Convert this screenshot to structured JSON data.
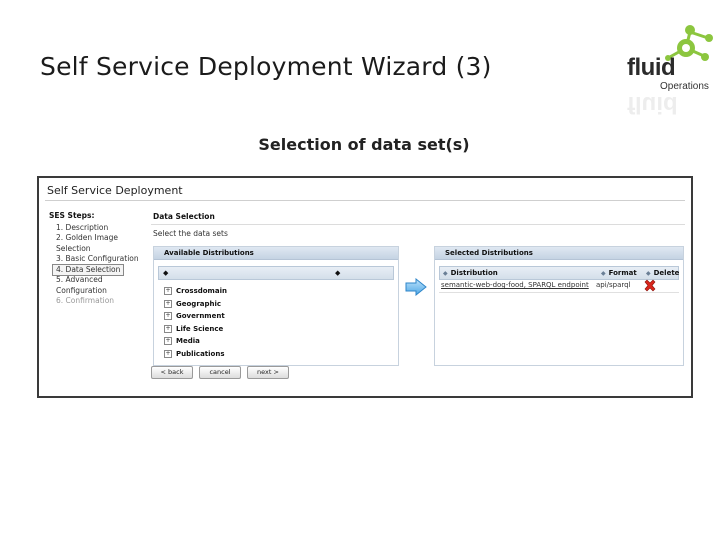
{
  "slide": {
    "title": "Self Service Deployment Wizard (3)",
    "subtitle": "Selection of data set(s)"
  },
  "logo": {
    "brand": "fluid",
    "sub": "Operations",
    "accent_color": "#8cc63f"
  },
  "app": {
    "title": "Self Service Deployment",
    "steps_header": "SES Steps:",
    "steps": [
      {
        "label": "1. Description",
        "state": "done"
      },
      {
        "label": "2. Golden Image Selection",
        "state": "done"
      },
      {
        "label": "3. Basic Configuration",
        "state": "done"
      },
      {
        "label": "4. Data Selection",
        "state": "current"
      },
      {
        "label": "5. Advanced Configuration",
        "state": "done"
      },
      {
        "label": "6. Confirmation",
        "state": "disabled"
      }
    ],
    "section_title": "Data Selection",
    "section_sub": "Select the data sets",
    "available": {
      "header": "Available Distributions",
      "items": [
        "Crossdomain",
        "Geographic",
        "Government",
        "Life Science",
        "Media",
        "Publications"
      ]
    },
    "selected": {
      "header": "Selected Distributions",
      "columns": {
        "distribution": "Distribution",
        "format": "Format",
        "delete": "Delete"
      },
      "rows": [
        {
          "distribution": "semantic-web-dog-food, SPARQL endpoint",
          "format": "api/sparql"
        }
      ]
    },
    "buttons": {
      "back": "< back",
      "cancel": "cancel",
      "next": "next >"
    }
  }
}
